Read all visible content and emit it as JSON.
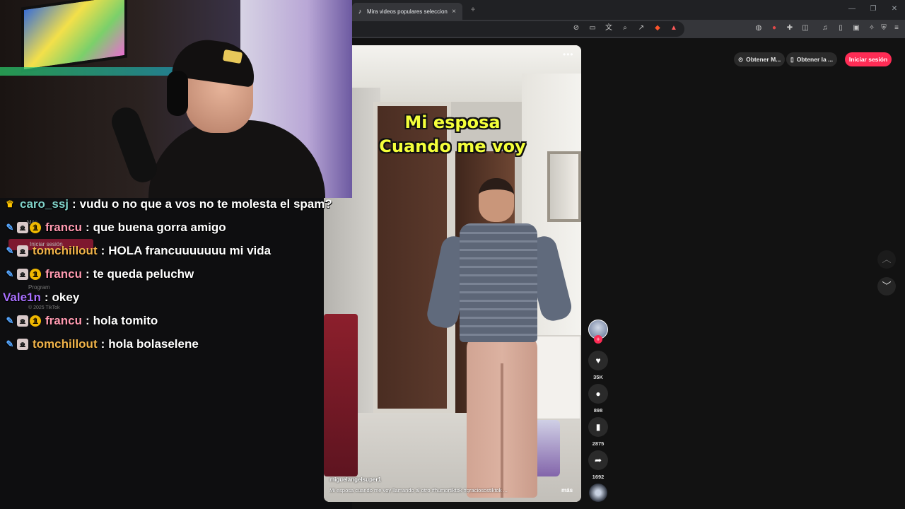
{
  "browser": {
    "tab_title": "Mira videos populares seleccion",
    "tab_close": "×",
    "new_tab": "+",
    "window": {
      "minimize": "—",
      "restore": "❐",
      "close": "✕"
    }
  },
  "tiktok": {
    "get_app_1": "Obtener M...",
    "get_app_2": "Obtener la ...",
    "login_label": "Iniciar sesión",
    "video": {
      "caption_line1": "Mi esposa",
      "caption_line2": "Cuando me voy",
      "more_dots": "•••",
      "author": "miguelangelsuper1",
      "description": "Mi esposa cuando me voy llamando al otro #humortiktok #graciosostiktok ...",
      "more_link": "más"
    },
    "actions": {
      "likes": "35K",
      "comments": "898",
      "saves": "2875",
      "shares": "1692"
    },
    "sidebar_ghost": {
      "mas": "Más",
      "login": "Iniciar sesión",
      "program": "Program",
      "copyright": "© 2025 TikTok"
    }
  },
  "chat": {
    "messages": [
      {
        "user": "caro_ssj",
        "text": "vudu o no que a vos no te molesta el spam?",
        "color": "#7fd1c8",
        "badges": [
          "crown"
        ]
      },
      {
        "user": "francu",
        "text": "que buena gorra amigo",
        "color": "#ff9ab1",
        "badges": [
          "wrench",
          "cat",
          "coin"
        ]
      },
      {
        "user": "tomchillout",
        "text": "HOLA francuuuuuuu mi vida",
        "color": "#f0b34a",
        "badges": [
          "wrench",
          "cat"
        ]
      },
      {
        "user": "francu",
        "text": "te queda peluchw",
        "color": "#ff9ab1",
        "badges": [
          "wrench",
          "cat",
          "coin"
        ]
      },
      {
        "user": "Vale1n",
        "text": "okey",
        "color": "#a970ff",
        "badges": []
      },
      {
        "user": "francu",
        "text": "hola tomito",
        "color": "#ff9ab1",
        "badges": [
          "wrench",
          "cat",
          "coin"
        ]
      },
      {
        "user": "tomchillout",
        "text": "hola bolaselene",
        "color": "#f0b34a",
        "badges": [
          "wrench",
          "cat"
        ]
      }
    ]
  }
}
